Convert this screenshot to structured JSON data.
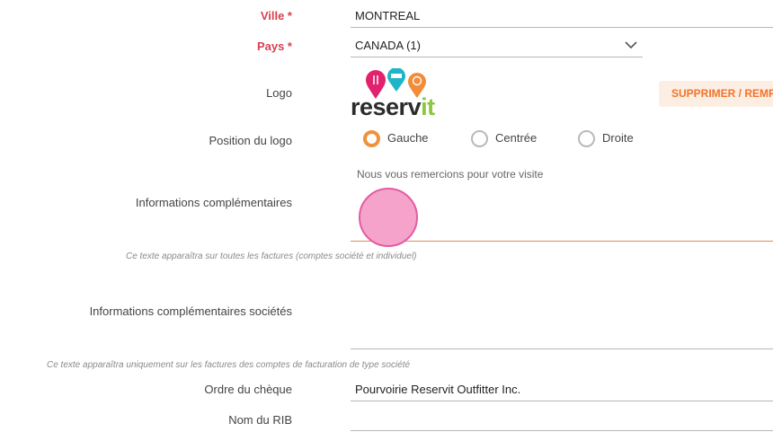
{
  "fields": {
    "city": {
      "label": "Ville *",
      "value": "MONTREAL"
    },
    "country": {
      "label": "Pays *",
      "value": "CANADA (1)"
    },
    "logo": {
      "label": "Logo",
      "brand_main": "reserv",
      "brand_accent": "it",
      "remove_label": "SUPPRIMER / REMPLACER"
    },
    "logo_position": {
      "label": "Position du logo",
      "options": [
        {
          "label": "Gauche",
          "selected": true
        },
        {
          "label": "Centrée",
          "selected": false
        },
        {
          "label": "Droite",
          "selected": false
        }
      ]
    },
    "extra_info": {
      "label": "Informations complémentaires",
      "value": "Nous vous remercions pour votre visite",
      "hint": "Ce texte apparaîtra sur toutes les factures (comptes société et individuel)"
    },
    "extra_info_companies": {
      "label": "Informations complémentaires sociétés",
      "value": "",
      "hint": "Ce texte apparaîtra uniquement sur les factures des comptes de facturation de type société"
    },
    "cheque_order": {
      "label": "Ordre du chèque",
      "value": "Pourvoirie Reservit Outfitter Inc."
    },
    "rib_name": {
      "label": "Nom du RIB",
      "value": ""
    }
  },
  "colors": {
    "accent": "#f0923b",
    "required": "#d9404f",
    "pin_pink": "#e2216f",
    "pin_teal": "#1fb5c8",
    "pin_orange": "#f28c38",
    "logo_green": "#8cc63f"
  }
}
